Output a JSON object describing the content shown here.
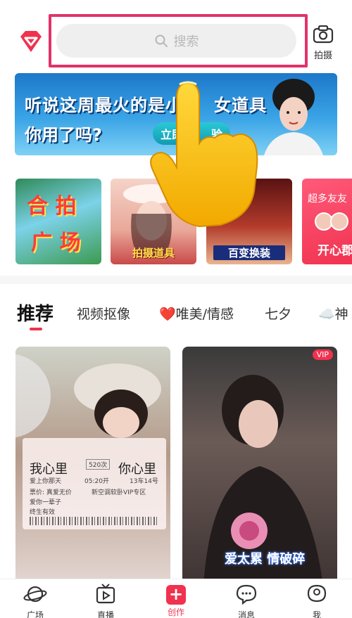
{
  "header": {
    "search": {
      "placeholder": "搜索"
    },
    "shoot_label": "拍摄",
    "logo_icon": "diamond-logo-icon"
  },
  "banner": {
    "line1": "听说这周最火的是小",
    "line1_end": "女道具",
    "line2": "你用了吗?",
    "cta": "立即",
    "cta_end": "验"
  },
  "feature_cards": [
    {
      "id": "hepai",
      "title_top": "合 拍",
      "title_bottom": "广 场"
    },
    {
      "id": "props",
      "caption": "拍摄道具"
    },
    {
      "id": "costume",
      "caption": "百变换装"
    },
    {
      "id": "friends",
      "top_text": "超多友友",
      "big_text": "开心郡"
    }
  ],
  "tabs": [
    {
      "label": "推荐",
      "active": true
    },
    {
      "label": "视频抠像"
    },
    {
      "label": "❤️唯美/情感"
    },
    {
      "label": "七夕"
    },
    {
      "label": "☁️神"
    }
  ],
  "feed": {
    "left": {
      "ticket_from": "我心里",
      "ticket_to": "你心里",
      "ticket_count": "520次",
      "line_a": "爱上你那天",
      "line_b": "05:20开",
      "line_c": "13车14号",
      "line_d": "票价: 真爱无价",
      "line_e": "新空调软卧VIP专区",
      "line_f": "爱你一辈子",
      "line_g": "终生有效"
    },
    "right": {
      "badge": "VIP",
      "caption": "爱太累 情破碎"
    }
  },
  "bottom_nav": [
    {
      "label": "广场",
      "icon": "planet-icon"
    },
    {
      "label": "直播",
      "icon": "tv-icon"
    },
    {
      "label": "创作",
      "icon": "plus-icon",
      "active": true
    },
    {
      "label": "消息",
      "icon": "chat-bubble-icon"
    },
    {
      "label": "我",
      "icon": "profile-icon"
    }
  ],
  "colors": {
    "accent": "#f0324f",
    "highlight_border": "#e1336a"
  }
}
